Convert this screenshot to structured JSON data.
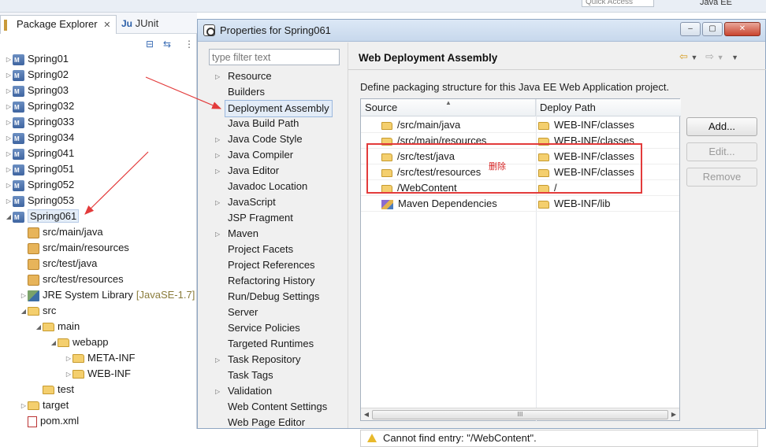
{
  "top": {
    "quick_access": "Quick Access",
    "perspective": "Java EE"
  },
  "explorer": {
    "tabs": [
      {
        "label": "Package Explorer",
        "close": "✕"
      },
      {
        "label": "JUnit"
      }
    ],
    "tree": [
      {
        "label": "Spring01",
        "kind": "project",
        "expanded": false
      },
      {
        "label": "Spring02",
        "kind": "project",
        "expanded": false
      },
      {
        "label": "Spring03",
        "kind": "project",
        "expanded": false
      },
      {
        "label": "Spring032",
        "kind": "project",
        "expanded": false
      },
      {
        "label": "Spring033",
        "kind": "project",
        "expanded": false
      },
      {
        "label": "Spring034",
        "kind": "project",
        "expanded": false
      },
      {
        "label": "Spring041",
        "kind": "project",
        "expanded": false
      },
      {
        "label": "Spring051",
        "kind": "project",
        "expanded": false
      },
      {
        "label": "Spring052",
        "kind": "project",
        "expanded": false
      },
      {
        "label": "Spring053",
        "kind": "project",
        "expanded": false
      },
      {
        "label": "Spring061",
        "kind": "project",
        "expanded": true,
        "selected": true
      },
      {
        "label": "src/main/java",
        "kind": "package"
      },
      {
        "label": "src/main/resources",
        "kind": "package"
      },
      {
        "label": "src/test/java",
        "kind": "package"
      },
      {
        "label": "src/test/resources",
        "kind": "package"
      },
      {
        "label": "JRE System Library",
        "suffix": "[JavaSE-1.7]",
        "kind": "library",
        "expanded": false
      },
      {
        "label": "src",
        "kind": "folder",
        "expanded": true
      },
      {
        "label": "main",
        "kind": "folder",
        "expanded": true
      },
      {
        "label": "webapp",
        "kind": "folder",
        "expanded": true
      },
      {
        "label": "META-INF",
        "kind": "folder",
        "expanded": false
      },
      {
        "label": "WEB-INF",
        "kind": "folder",
        "expanded": false
      },
      {
        "label": "test",
        "kind": "folder"
      },
      {
        "label": "target",
        "kind": "folder",
        "expanded": false
      },
      {
        "label": "pom.xml",
        "kind": "xml"
      }
    ]
  },
  "dialog": {
    "title": "Properties for Spring061",
    "window_buttons": {
      "minimize": "‒",
      "maximize": "▢",
      "close": "✕"
    },
    "filter_placeholder": "type filter text",
    "nav": [
      {
        "label": "Resource",
        "arrow": true
      },
      {
        "label": "Builders",
        "arrow": false
      },
      {
        "label": "Deployment Assembly",
        "arrow": false,
        "selected": true
      },
      {
        "label": "Java Build Path",
        "arrow": false
      },
      {
        "label": "Java Code Style",
        "arrow": true
      },
      {
        "label": "Java Compiler",
        "arrow": true
      },
      {
        "label": "Java Editor",
        "arrow": true
      },
      {
        "label": "Javadoc Location",
        "arrow": false
      },
      {
        "label": "JavaScript",
        "arrow": true
      },
      {
        "label": "JSP Fragment",
        "arrow": false
      },
      {
        "label": "Maven",
        "arrow": true
      },
      {
        "label": "Project Facets",
        "arrow": false
      },
      {
        "label": "Project References",
        "arrow": false
      },
      {
        "label": "Refactoring History",
        "arrow": false
      },
      {
        "label": "Run/Debug Settings",
        "arrow": false
      },
      {
        "label": "Server",
        "arrow": false
      },
      {
        "label": "Service Policies",
        "arrow": false
      },
      {
        "label": "Targeted Runtimes",
        "arrow": false
      },
      {
        "label": "Task Repository",
        "arrow": true
      },
      {
        "label": "Task Tags",
        "arrow": false
      },
      {
        "label": "Validation",
        "arrow": true
      },
      {
        "label": "Web Content Settings",
        "arrow": false
      },
      {
        "label": "Web Page Editor",
        "arrow": false
      }
    ],
    "page": {
      "title": "Web Deployment Assembly",
      "description": "Define packaging structure for this Java EE Web Application project.",
      "columns": {
        "source": "Source",
        "deploy_path": "Deploy Path"
      },
      "rows": [
        {
          "source": "/src/main/java",
          "deploy_path": "WEB-INF/classes",
          "icon": "folder"
        },
        {
          "source": "/src/main/resources",
          "deploy_path": "WEB-INF/classes",
          "icon": "folder"
        },
        {
          "source": "/src/test/java",
          "deploy_path": "WEB-INF/classes",
          "icon": "folder"
        },
        {
          "source": "/src/test/resources",
          "deploy_path": "WEB-INF/classes",
          "icon": "folder"
        },
        {
          "source": "/WebContent",
          "deploy_path": "/",
          "icon": "folder"
        },
        {
          "source": "Maven Dependencies",
          "deploy_path": "WEB-INF/lib",
          "icon": "maven"
        }
      ],
      "buttons": {
        "add": "Add...",
        "edit": "Edit...",
        "remove": "Remove"
      },
      "scroll_label": "III",
      "status": "Cannot find entry: \"/WebContent\"."
    }
  },
  "annotation": {
    "note": "删除",
    "color": "#e33b3b"
  }
}
